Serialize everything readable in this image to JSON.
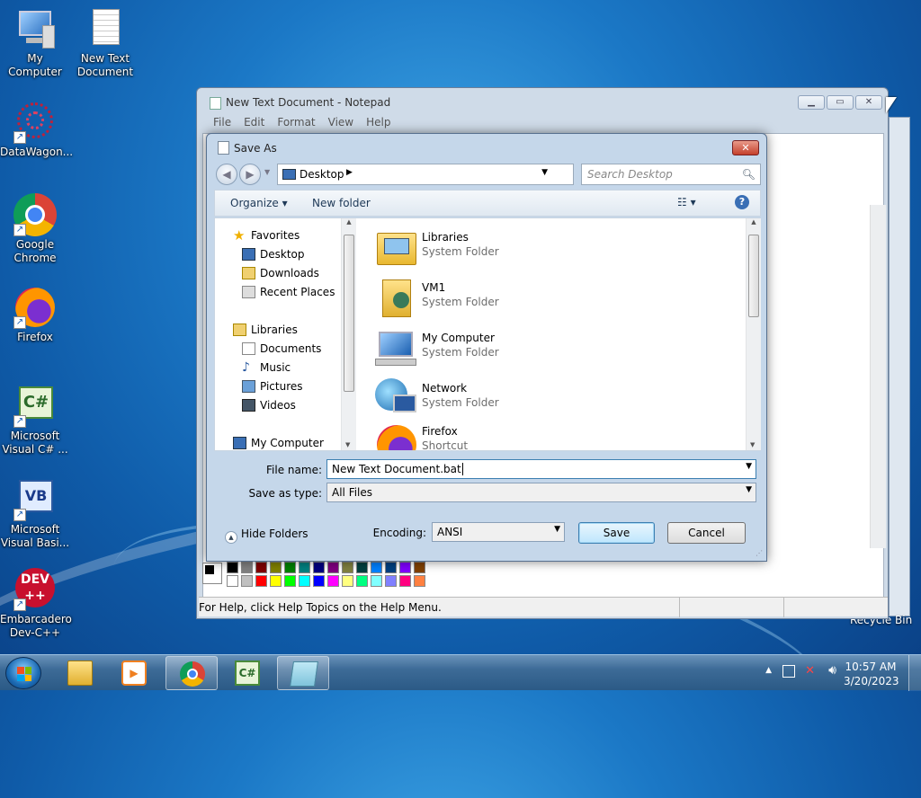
{
  "desktop": {
    "icons": [
      {
        "label": "My Computer",
        "icon": "computer-icon"
      },
      {
        "label": "New Text Document",
        "icon": "text-file-icon"
      },
      {
        "label": "DataWagon...",
        "icon": "datawagon-icon"
      },
      {
        "label": "Google Chrome",
        "icon": "chrome-icon"
      },
      {
        "label": "Firefox",
        "icon": "firefox-icon"
      },
      {
        "label": "Microsoft Visual C# ...",
        "icon": "visual-csharp-icon"
      },
      {
        "label": "Microsoft Visual Basi...",
        "icon": "visual-basic-icon"
      },
      {
        "label": "Embarcadero Dev-C++",
        "icon": "devcpp-icon"
      }
    ],
    "recycle_bin_label": "Recycle Bin"
  },
  "notepad": {
    "title": "New Text Document - Notepad",
    "menu": [
      "File",
      "Edit",
      "Format",
      "View",
      "Help"
    ],
    "status_text": "For Help, click Help Topics on the Help Menu."
  },
  "save_as": {
    "title": "Save As",
    "address": "Desktop",
    "search_placeholder": "Search Desktop",
    "toolbar": {
      "organize": "Organize",
      "new_folder": "New folder"
    },
    "nav_tree": [
      {
        "label": "Favorites",
        "icon": "star-icon"
      },
      {
        "label": "Desktop",
        "icon": "desktop-icon"
      },
      {
        "label": "Downloads",
        "icon": "downloads-icon"
      },
      {
        "label": "Recent Places",
        "icon": "recent-places-icon"
      },
      {
        "label": "Libraries",
        "icon": "libraries-icon"
      },
      {
        "label": "Documents",
        "icon": "documents-icon"
      },
      {
        "label": "Music",
        "icon": "music-icon"
      },
      {
        "label": "Pictures",
        "icon": "pictures-icon"
      },
      {
        "label": "Videos",
        "icon": "videos-icon"
      },
      {
        "label": "My Computer",
        "icon": "computer-icon"
      }
    ],
    "files": [
      {
        "name": "Libraries",
        "type": "System Folder",
        "icon": "libraries-folder-icon"
      },
      {
        "name": "VM1",
        "type": "System Folder",
        "icon": "user-folder-icon"
      },
      {
        "name": "My Computer",
        "type": "System Folder",
        "icon": "computer-icon"
      },
      {
        "name": "Network",
        "type": "System Folder",
        "icon": "network-icon"
      },
      {
        "name": "Firefox",
        "type": "Shortcut",
        "icon": "firefox-icon"
      }
    ],
    "file_name_label": "File name:",
    "file_name_value": "New Text Document.bat",
    "save_as_type_label": "Save as type:",
    "save_as_type_value": "All Files",
    "encoding_label": "Encoding:",
    "encoding_value": "ANSI",
    "save_label": "Save",
    "cancel_label": "Cancel",
    "hide_folders_label": "Hide Folders"
  },
  "taskbar": {
    "items": [
      "explorer-icon",
      "media-player-icon",
      "chrome-icon",
      "visual-csharp-icon",
      "notepad-icon"
    ],
    "time": "10:57 AM",
    "date": "3/20/2023"
  },
  "palette_colors": {
    "row1": [
      "#000000",
      "#808080",
      "#800000",
      "#808000",
      "#008000",
      "#008080",
      "#000080",
      "#800080",
      "#808040",
      "#004040",
      "#0080ff",
      "#004080",
      "#8000ff",
      "#804000"
    ],
    "row2": [
      "#ffffff",
      "#c0c0c0",
      "#ff0000",
      "#ffff00",
      "#00ff00",
      "#00ffff",
      "#0000ff",
      "#ff00ff",
      "#ffff80",
      "#00ff80",
      "#80ffff",
      "#8080ff",
      "#ff0080",
      "#ff8040"
    ]
  }
}
